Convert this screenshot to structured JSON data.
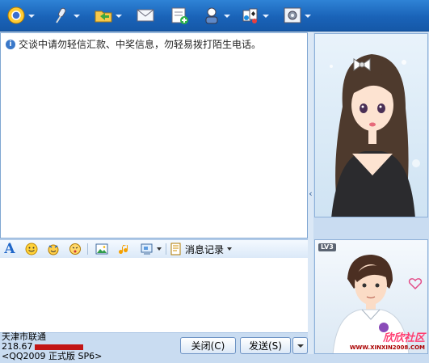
{
  "toolbar": {
    "buttons": [
      "video-icon",
      "microphone-icon",
      "folder-icon",
      "mail-icon",
      "add-app-icon",
      "settings-person-icon",
      "game-icon",
      "config-icon"
    ]
  },
  "chat": {
    "notice": "交谈中请勿轻信汇款、中奖信息，勿轻易拨打陌生电话。"
  },
  "input_toolbar": {
    "history_label": "消息记录"
  },
  "status": {
    "line1": "天津市联通",
    "line2": "218.67",
    "line3": "<QQ2009 正式版 SP6>"
  },
  "buttons": {
    "close_label": "关闭(C)",
    "send_label": "发送(S)"
  },
  "show": {
    "level_label": "LV3",
    "watermark_main": "欣欣社区",
    "watermark_url": "WWW.XINXIN2008.COM"
  },
  "colors": {
    "toolbar_blue": "#1a63b8",
    "accent": "#3a78c9",
    "redaction": "#c21515"
  }
}
